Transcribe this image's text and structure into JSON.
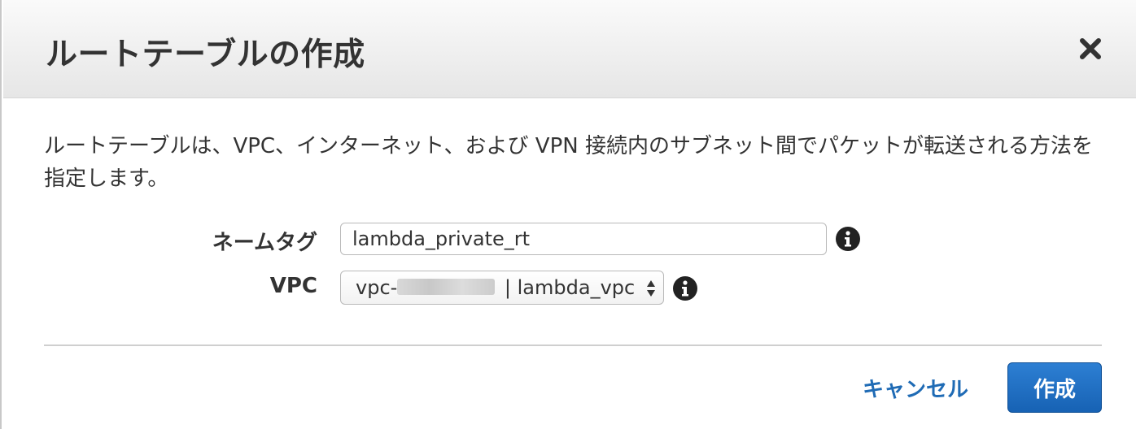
{
  "dialog": {
    "title": "ルートテーブルの作成",
    "close_icon": "close-icon",
    "description": "ルートテーブルは、VPC、インターネット、および VPN 接続内のサブネット間でパケットが転送される方法を指定します。"
  },
  "form": {
    "name_tag": {
      "label": "ネームタグ",
      "value": "lambda_private_rt",
      "info_icon": "info-icon"
    },
    "vpc": {
      "label": "VPC",
      "selected_prefix": "vpc-",
      "selected_suffix": " | lambda_vpc",
      "info_icon": "info-icon"
    }
  },
  "footer": {
    "cancel_label": "キャンセル",
    "create_label": "作成"
  },
  "colors": {
    "primary_button": "#1f6bb5",
    "link": "#1f6bb5",
    "header_bg": "#ececec"
  }
}
